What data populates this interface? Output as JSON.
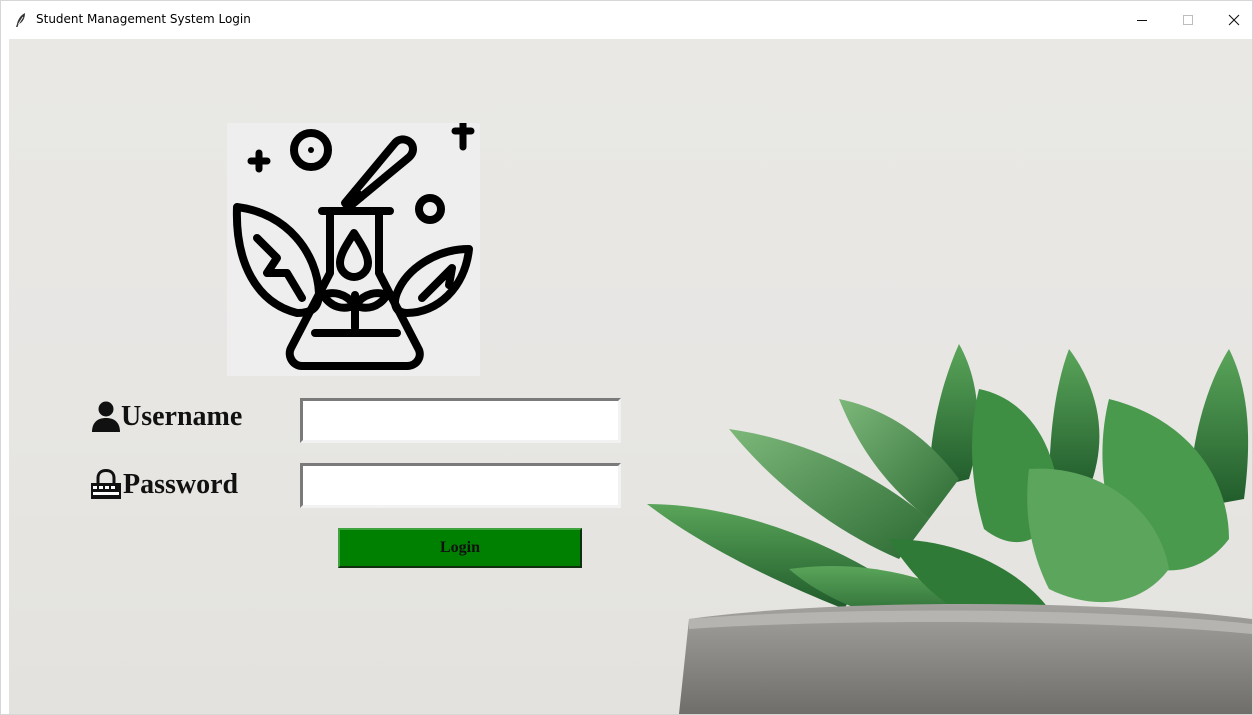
{
  "window": {
    "title": "Student Management System Login",
    "controls": {
      "minimize": "minimize",
      "maximize": "maximize",
      "close": "close"
    }
  },
  "form": {
    "username_label": "Username",
    "password_label": "Password",
    "username_value": "",
    "password_value": "",
    "login_label": "Login"
  },
  "icons": {
    "app": "feather-icon",
    "logo": "lab-flask-leaves-icon",
    "username": "user-icon",
    "password": "lock-icon"
  },
  "colors": {
    "login_button": "#008000",
    "background": "#e8e7e4",
    "plant_green": "#3f8a3f",
    "pot_gray": "#8d8c88"
  }
}
